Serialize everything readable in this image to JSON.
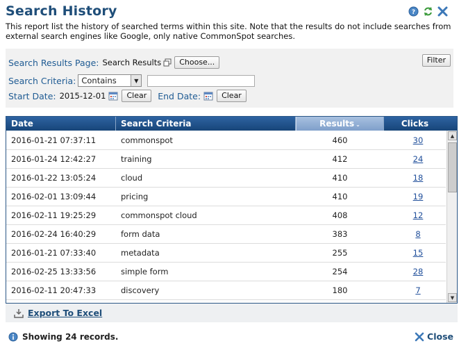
{
  "page": {
    "title": "Search History",
    "description": "This report list the history of searched terms within this site. Note that the results do not include searches from external search engines like Google, only native CommonSpot searches."
  },
  "filters": {
    "results_page_label": "Search Results Page:",
    "results_page_value": "Search Results",
    "choose_label": "Choose...",
    "filter_label": "Filter",
    "criteria_label": "Search Criteria:",
    "criteria_mode": "Contains",
    "criteria_text": "",
    "start_label": "Start Date:",
    "start_value": "2015-12-01",
    "end_label": "End Date:",
    "clear_label": "Clear"
  },
  "table": {
    "columns": [
      "Date",
      "Search Criteria",
      "Results",
      "Clicks"
    ],
    "rows": [
      {
        "date": "2016-01-21 07:37:11",
        "criteria": "commonspot",
        "results": "460",
        "clicks": "30"
      },
      {
        "date": "2016-01-24 12:42:27",
        "criteria": "training",
        "results": "412",
        "clicks": "24"
      },
      {
        "date": "2016-01-22 13:05:24",
        "criteria": "cloud",
        "results": "410",
        "clicks": "18"
      },
      {
        "date": "2016-02-01 13:09:44",
        "criteria": "pricing",
        "results": "410",
        "clicks": "19"
      },
      {
        "date": "2016-02-11 19:25:29",
        "criteria": "commonspot cloud",
        "results": "408",
        "clicks": "12"
      },
      {
        "date": "2016-02-24 16:40:29",
        "criteria": "form data",
        "results": "383",
        "clicks": "8"
      },
      {
        "date": "2016-01-21 07:33:40",
        "criteria": "metadata",
        "results": "255",
        "clicks": "15"
      },
      {
        "date": "2016-02-25 13:33:56",
        "criteria": "simple form",
        "results": "254",
        "clicks": "28"
      },
      {
        "date": "2016-02-11 20:47:33",
        "criteria": "discovery",
        "results": "180",
        "clicks": "7"
      }
    ]
  },
  "export_label": "Export To Excel",
  "footer": {
    "records_text": "Showing 24 records.",
    "close_label": "Close"
  },
  "icons": {
    "help": "help-icon",
    "refresh": "refresh-icon",
    "close": "close-icon",
    "popup": "popup-icon",
    "calendar": "calendar-icon",
    "export": "export-icon",
    "info": "info-icon"
  },
  "colors": {
    "title": "#1f4e79",
    "label": "#1f5b93",
    "header_bg": "#1f5290",
    "sorted_header_bg": "#94b1d6",
    "link": "#1f4e9a"
  }
}
